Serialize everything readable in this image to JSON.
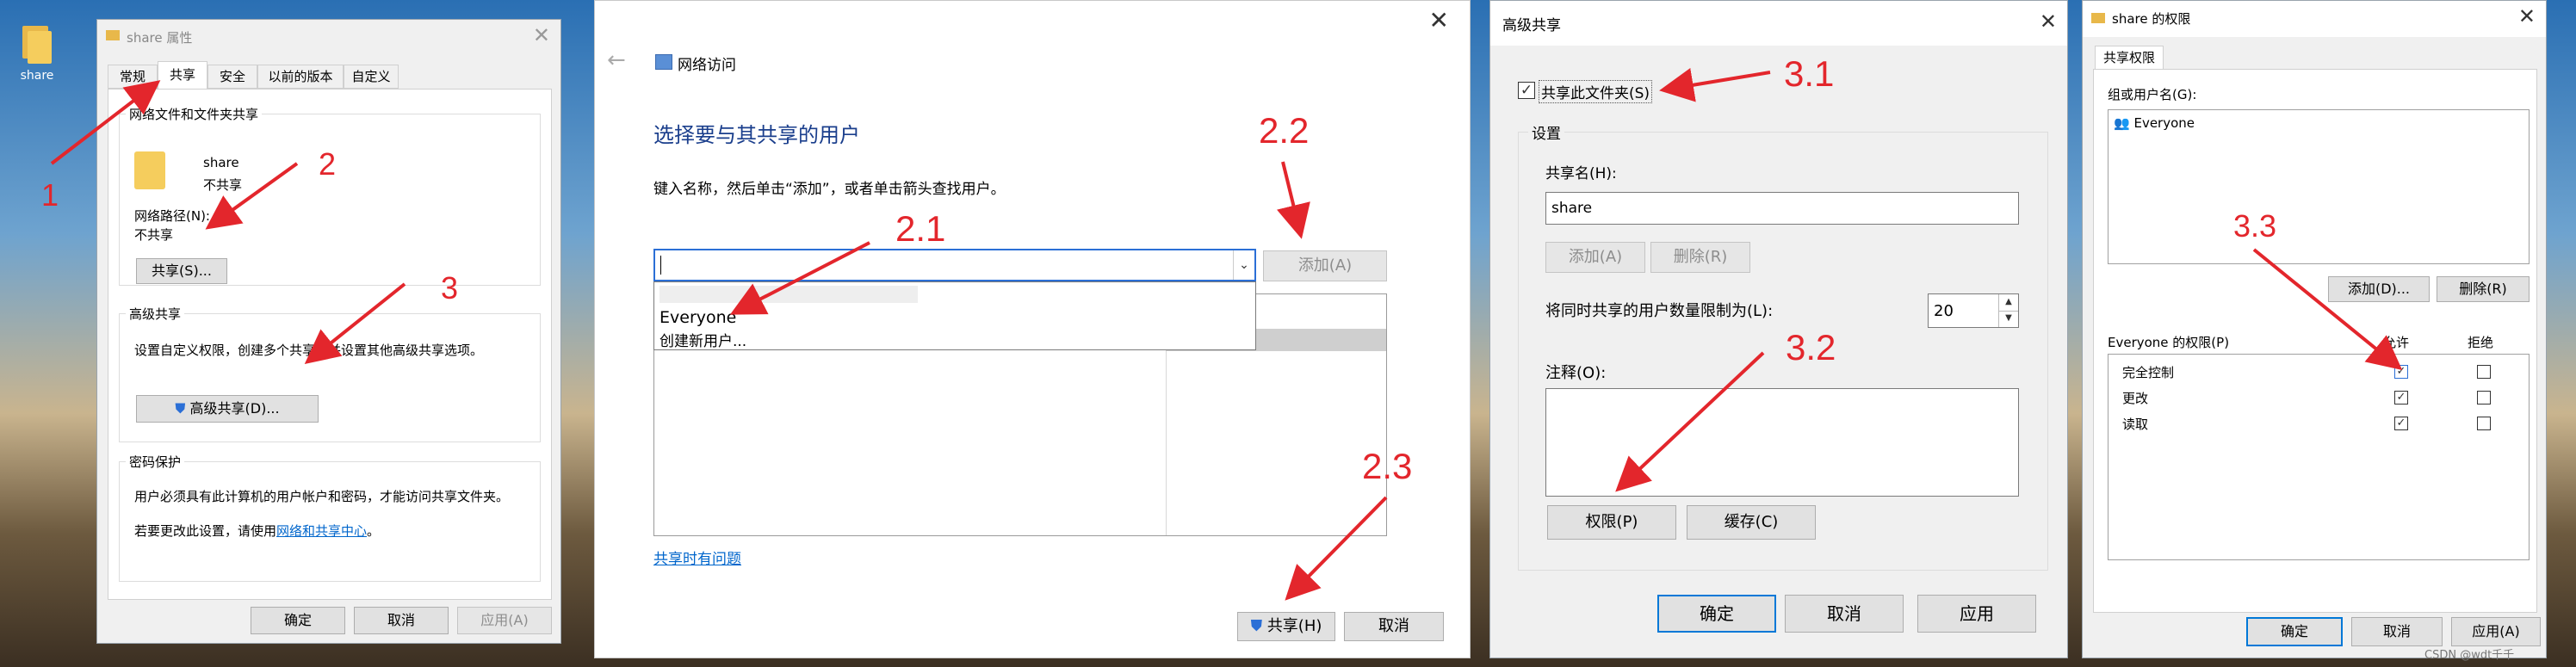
{
  "desktop": {
    "icon_label": "share"
  },
  "props": {
    "title": "share 属性",
    "tabs": [
      "常规",
      "共享",
      "安全",
      "以前的版本",
      "自定义"
    ],
    "net_group": "网络文件和文件夹共享",
    "folder_name": "share",
    "folder_state": "不共享",
    "path_label": "网络路径(N):",
    "path_value": "不共享",
    "share_btn": "共享(S)...",
    "adv_group": "高级共享",
    "adv_desc": "设置自定义权限，创建多个共享，并设置其他高级共享选项。",
    "adv_btn": "高级共享(D)...",
    "pwd_group": "密码保护",
    "pwd_desc": "用户必须具有此计算机的用户帐户和密码，才能访问共享文件夹。",
    "pwd_change_prefix": "若要更改此设置，请使用",
    "pwd_link": "网络和共享中心",
    "pwd_suffix": "。",
    "ok": "确定",
    "cancel": "取消",
    "apply": "应用(A)"
  },
  "netaccess": {
    "title": "网络访问",
    "heading": "选择要与其共享的用户",
    "instruction": "键入名称，然后单击“添加”，或者单击箭头查找用户。",
    "add_btn": "添加(A)",
    "dropdown_items": [
      "Everyone",
      "创建新用户..."
    ],
    "trouble_link": "共享时有问题",
    "share_btn": "共享(H)",
    "cancel": "取消"
  },
  "advanced": {
    "title": "高级共享",
    "share_checkbox": "共享此文件夹(S)",
    "settings_group": "设置",
    "share_name_label": "共享名(H):",
    "share_name_value": "share",
    "add_btn": "添加(A)",
    "remove_btn": "删除(R)",
    "limit_label": "将同时共享的用户数量限制为(L):",
    "limit_value": "20",
    "comment_label": "注释(O):",
    "perm_btn": "权限(P)",
    "cache_btn": "缓存(C)",
    "ok": "确定",
    "cancel": "取消",
    "apply": "应用"
  },
  "permissions": {
    "title": "share 的权限",
    "tab": "共享权限",
    "group_label": "组或用户名(G):",
    "users": [
      "Everyone"
    ],
    "add_btn": "添加(D)...",
    "remove_btn": "删除(R)",
    "perm_header": "Everyone 的权限(P)",
    "allow_header": "允许",
    "deny_header": "拒绝",
    "rows": [
      {
        "name": "完全控制",
        "allow": true,
        "deny": false
      },
      {
        "name": "更改",
        "allow": true,
        "deny": false
      },
      {
        "name": "读取",
        "allow": true,
        "deny": false
      }
    ],
    "ok": "确定",
    "cancel": "取消",
    "apply": "应用(A)"
  },
  "annotations": {
    "a1": "1",
    "a2": "2",
    "a3": "3",
    "a21": "2.1",
    "a22": "2.2",
    "a23": "2.3",
    "a31": "3.1",
    "a32": "3.2",
    "a33": "3.3",
    "color": "#e3262c"
  },
  "watermark": "CSDN @wdt千千"
}
